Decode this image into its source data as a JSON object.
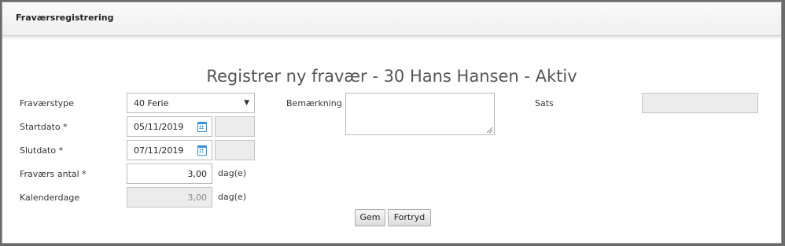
{
  "dialog": {
    "title": "Fraværsregistrering",
    "heading": "Registrer ny fravær - 30 Hans Hansen - Aktiv"
  },
  "form": {
    "type_label": "Fraværstype",
    "type_value": "40 Ferie",
    "start_label": "Startdato *",
    "start_value": "05/11/2019",
    "end_label": "Slutdato *",
    "end_value": "07/11/2019",
    "amount_label": "Fraværs antal *",
    "amount_value": "3,00",
    "amount_unit": "dag(e)",
    "calendar_label": "Kalenderdage",
    "calendar_value": "3,00",
    "calendar_unit": "dag(e)",
    "remark_label": "Bemærkning",
    "remark_value": "",
    "rate_label": "Sats",
    "rate_value": ""
  },
  "buttons": {
    "save": "Gem",
    "cancel": "Fortryd"
  },
  "icons": {
    "dropdown": "chevron-down-icon",
    "calendar": "calendar-icon"
  },
  "colors": {
    "accent": "#3a8fd1"
  }
}
